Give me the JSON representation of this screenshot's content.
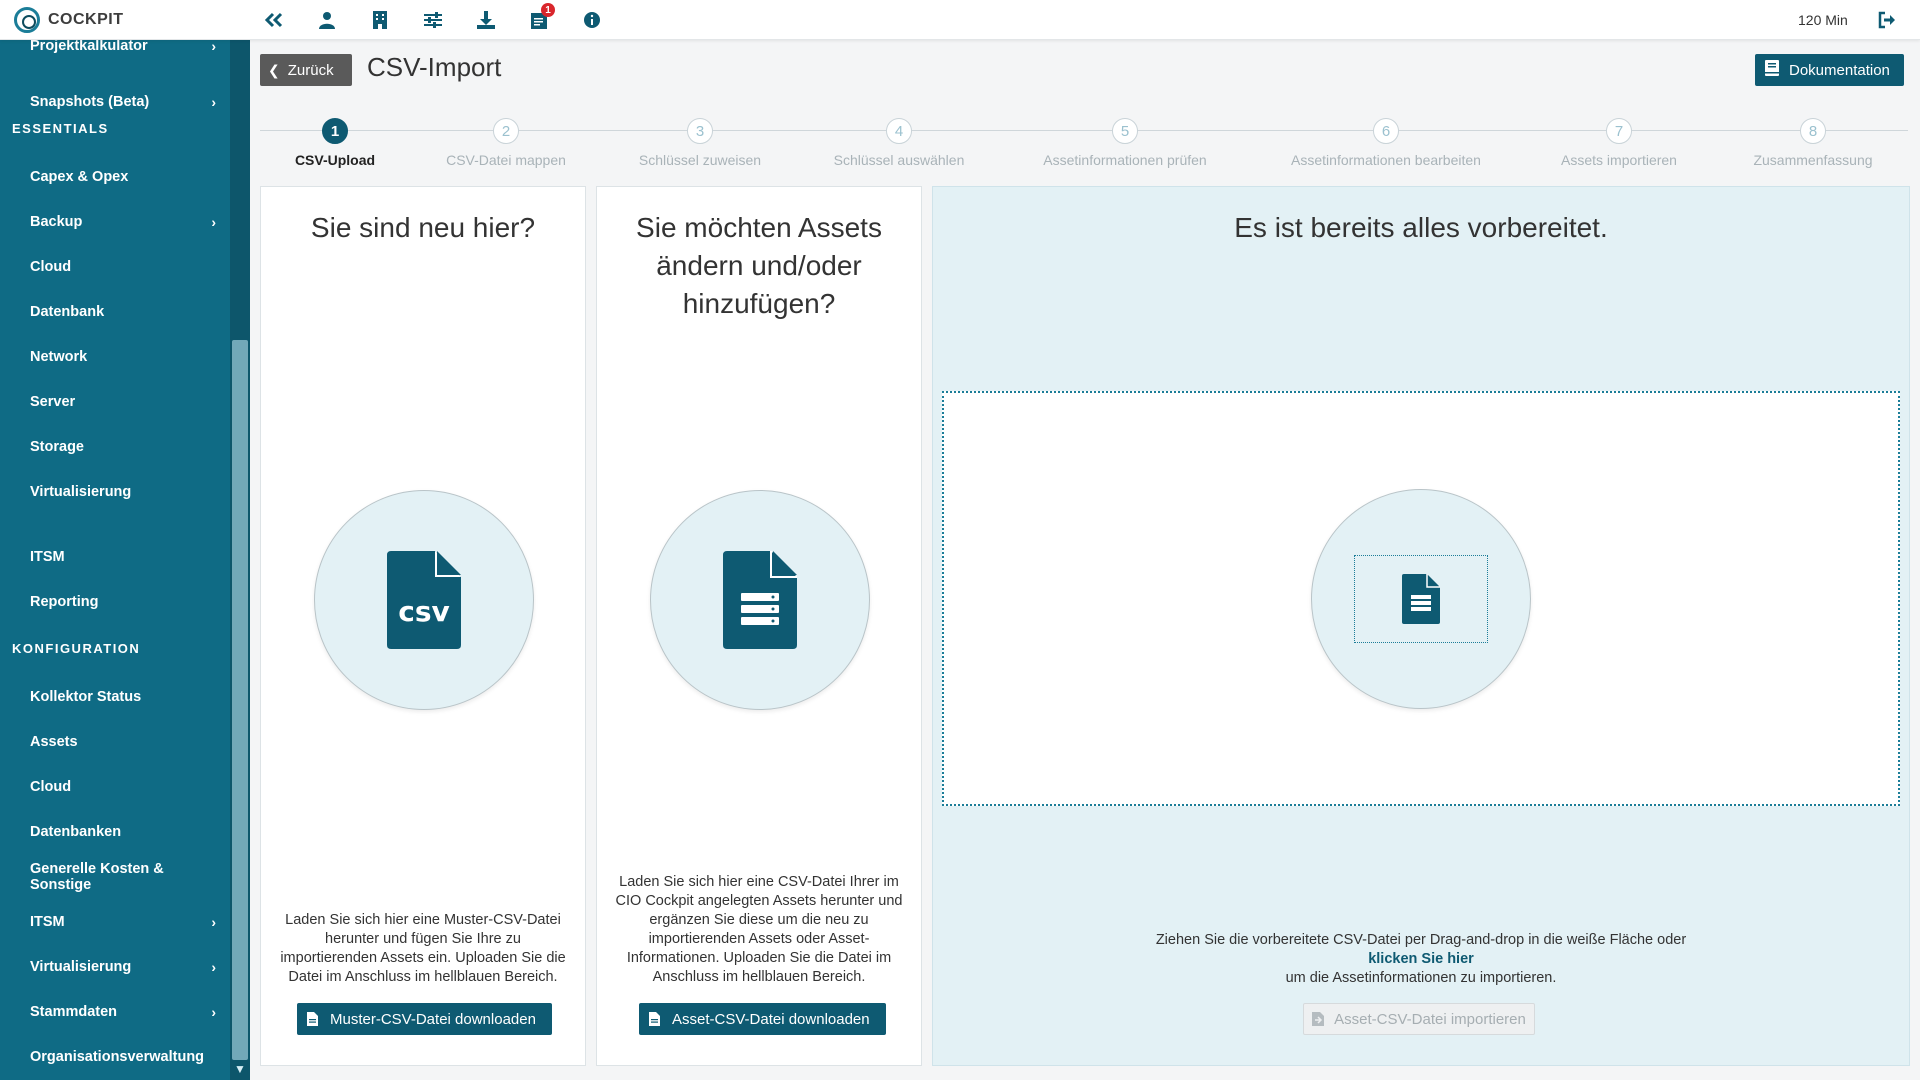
{
  "brand": {
    "name": "COCKPIT"
  },
  "topbar": {
    "icons": [
      "double-chevron-left-icon",
      "user-icon",
      "building-icon",
      "sliders-icon",
      "download-icon",
      "notes-icon",
      "info-icon"
    ],
    "notification_badge": "1",
    "timer": "120 Min"
  },
  "sidebar": {
    "items_top": [
      {
        "label": "Projektkalkulator",
        "chevron": true
      },
      {
        "label": "Snapshots (Beta)",
        "chevron": true
      }
    ],
    "section_essentials": "ESSENTIALS",
    "essentials": [
      {
        "label": "Capex & Opex",
        "chevron": false
      },
      {
        "label": "Backup",
        "chevron": true
      },
      {
        "label": "Cloud",
        "chevron": false
      },
      {
        "label": "Datenbank",
        "chevron": false
      },
      {
        "label": "Network",
        "chevron": false
      },
      {
        "label": "Server",
        "chevron": false
      },
      {
        "label": "Storage",
        "chevron": false
      },
      {
        "label": "Virtualisierung",
        "chevron": false
      },
      {
        "label": "ITSM",
        "chevron": false
      },
      {
        "label": "Reporting",
        "chevron": false
      }
    ],
    "section_config": "KONFIGURATION",
    "config": [
      {
        "label": "Kollektor Status",
        "chevron": false
      },
      {
        "label": "Assets",
        "chevron": false
      },
      {
        "label": "Cloud",
        "chevron": false
      },
      {
        "label": "Datenbanken",
        "chevron": false
      },
      {
        "label": "Generelle Kosten & Sonstige",
        "chevron": false
      },
      {
        "label": "ITSM",
        "chevron": true
      },
      {
        "label": "Virtualisierung",
        "chevron": true
      },
      {
        "label": "Stammdaten",
        "chevron": true
      },
      {
        "label": "Organisationsverwaltung",
        "chevron": false
      }
    ]
  },
  "header": {
    "back_label": "Zurück",
    "title": "CSV-Import",
    "doc_label": "Dokumentation"
  },
  "stepper": {
    "active": 1,
    "steps": [
      {
        "num": "1",
        "label": "CSV-Upload"
      },
      {
        "num": "2",
        "label": "CSV-Datei mappen"
      },
      {
        "num": "3",
        "label": "Schlüssel zuweisen"
      },
      {
        "num": "4",
        "label": "Schlüssel auswählen"
      },
      {
        "num": "5",
        "label": "Assetinformationen prüfen"
      },
      {
        "num": "6",
        "label": "Assetinformationen bearbeiten"
      },
      {
        "num": "7",
        "label": "Assets importieren"
      },
      {
        "num": "8",
        "label": "Zusammenfassung"
      }
    ]
  },
  "panels": {
    "new": {
      "title": "Sie sind neu hier?",
      "icon": "csv-file-icon",
      "text": "Laden Sie sich hier eine Muster-CSV-Datei herunter und fügen Sie Ihre zu importierenden Assets ein. Uploaden Sie die Datei im Anschluss im hellblauen Bereich.",
      "button": "Muster-CSV-Datei downloaden"
    },
    "change": {
      "title": "Sie möchten Assets ändern und/oder hinzufügen?",
      "icon": "server-file-icon",
      "text": "Laden Sie sich hier eine CSV-Datei Ihrer im CIO Cockpit angelegten Assets herunter und ergänzen Sie diese um die neu zu importierenden Assets oder Asset-Informationen. Uploaden Sie die Datei im Anschluss im hellblauen Bereich.",
      "button": "Asset-CSV-Datei downloaden"
    },
    "ready": {
      "title": "Es ist bereits alles vorbereitet.",
      "icon": "server-file-icon",
      "text_before": "Ziehen Sie die vorbereitete CSV-Datei per Drag-and-drop in die weiße Fläche oder",
      "link": "klicken Sie hier",
      "text_after": "um die Assetinformationen zu importieren.",
      "button": "Asset-CSV-Datei importieren"
    }
  }
}
